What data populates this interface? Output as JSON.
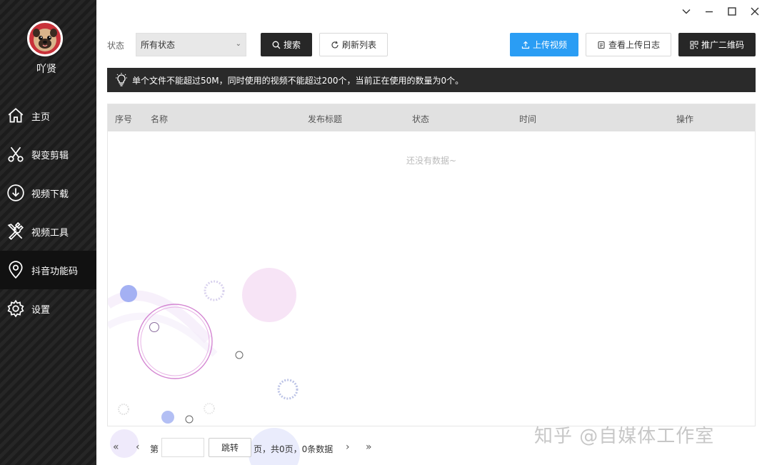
{
  "sidebar": {
    "username": "吖贤",
    "items": [
      {
        "label": "主页",
        "icon": "home-icon"
      },
      {
        "label": "裂变剪辑",
        "icon": "scissors-icon"
      },
      {
        "label": "视频下载",
        "icon": "download-icon"
      },
      {
        "label": "视频工具",
        "icon": "tools-icon"
      },
      {
        "label": "抖音功能码",
        "icon": "location-pin-icon"
      },
      {
        "label": "设置",
        "icon": "gear-icon"
      }
    ],
    "active_index": 4
  },
  "toolbar": {
    "status_label": "状态",
    "status_value": "所有状态",
    "search_label": "搜索",
    "refresh_label": "刷新列表",
    "upload_label": "上传视频",
    "log_label": "查看上传日志",
    "qr_label": "推广二维码"
  },
  "notice": {
    "text": "单个文件不能超过50M，同时使用的视频不能超过200个，当前正在使用的数量为0个。"
  },
  "table": {
    "columns": [
      "序号",
      "名称",
      "发布标题",
      "状态",
      "时间",
      "操作"
    ],
    "rows": [],
    "empty_text": "还没有数据~"
  },
  "pagination": {
    "page_prefix": "第",
    "page_value": "",
    "jump_label": "跳转",
    "summary": "页，共0页，0条数据"
  },
  "watermark": "知乎 @自媒体工作室",
  "colors": {
    "sidebar_bg": "#1f1f1f",
    "primary_blue": "#2a9df4",
    "dark_button": "#272727",
    "avatar_red": "#c8323a"
  }
}
